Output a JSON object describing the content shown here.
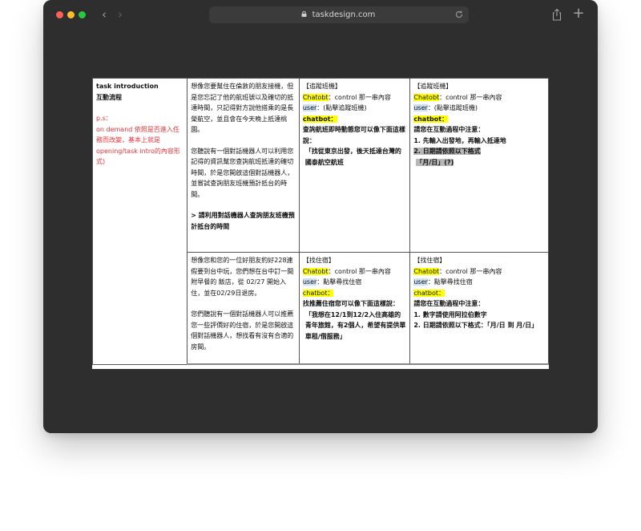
{
  "browser": {
    "url": "taskdesign.com"
  },
  "table": {
    "col1": {
      "title_line1": "task introduction",
      "title_line2": "互動流程",
      "ps_label": "p.s：",
      "ps_text": "on demand 依照是否進入任務而改變，基本上就是opening/task intro的內容形式)"
    },
    "row1": {
      "intro": {
        "p1": "想像您要幫住在倫敦的朋友接機，但是您忘記了他的航班號以及確切的抵達時間，只記得對方說他搭乘的是長榮航空，並且會在今天晚上抵達桃園。",
        "p2": "您聽說有一個對話機器人可以利用您記得的資訊幫您查詢航班抵達的確切時間，於是您開啟這個對話機器人，並嘗試查詢朋友班機預計抵台的時間。",
        "p3": "> 請利用對話機器人查詢朋友班機預計抵台的時間"
      },
      "demo1": {
        "tag": "【追蹤班機】",
        "chatbot_label": "Chatobt",
        "chatbot_text": "：control 那一串內容",
        "user_label": "user",
        "user_text": "：(點擊追蹤班機)",
        "chatbot2_label": "chatbot：",
        "line1": "查詢航班即時動態您可以像下面這樣說：",
        "line2": "「找從東京出發，後天抵達台灣的國泰航空航班"
      },
      "demo2": {
        "tag": "【追蹤班機】",
        "chatbot_label": "Chatobt",
        "chatbot_text": "：control 那一串內容",
        "user_label": "user",
        "user_text": "：(點擊追蹤班機)",
        "chatbot2_label": "chatbot：",
        "line1": "請您在互動過程中注意：",
        "line2": "1. 先輸入出發地，再輸入抵達地",
        "line3": "2. 日期請依照以下格式",
        "line4": "「月/日」(?)"
      }
    },
    "row2": {
      "intro": {
        "p1": "想像您和您的一位好朋友約好228連假要到台中玩，您們想在台中訂一間 附早餐的 飯店，從 02/27 開始入住，並在02/29日退房。",
        "p2": "您們聽說有一個對話機器人可以推薦您一些評價好的住宿，於是您開啟這個對話機器人，想找看有沒有合適的房間。"
      },
      "demo1": {
        "tag": "【找住宿】",
        "chatbot_label": "Chatobt",
        "chatbot_text": "：control 那一串內容",
        "user_label": "user",
        "user_text": "：點擊尋找住宿",
        "chatbot2_label": "chatbot：",
        "line1": "找推薦住宿您可以像下面這樣說：",
        "line2": "「我想在12/1到12/2入住高雄的青年旅館，有2個人，希望有提供單車租/借服務」"
      },
      "demo2": {
        "tag": "【找住宿】",
        "chatbot_label": "Chatobt",
        "chatbot_text": "：control 那一串內容",
        "user_label": "user",
        "user_text": "：點擊尋找住宿",
        "chatbot2_label": "chatbot：",
        "line1": "請您在互動過程中注意：",
        "line2": "1. 數字請使用阿拉伯數字",
        "line3": "2. 日期請依照以下格式：「月/日 到 月/日」"
      }
    }
  }
}
